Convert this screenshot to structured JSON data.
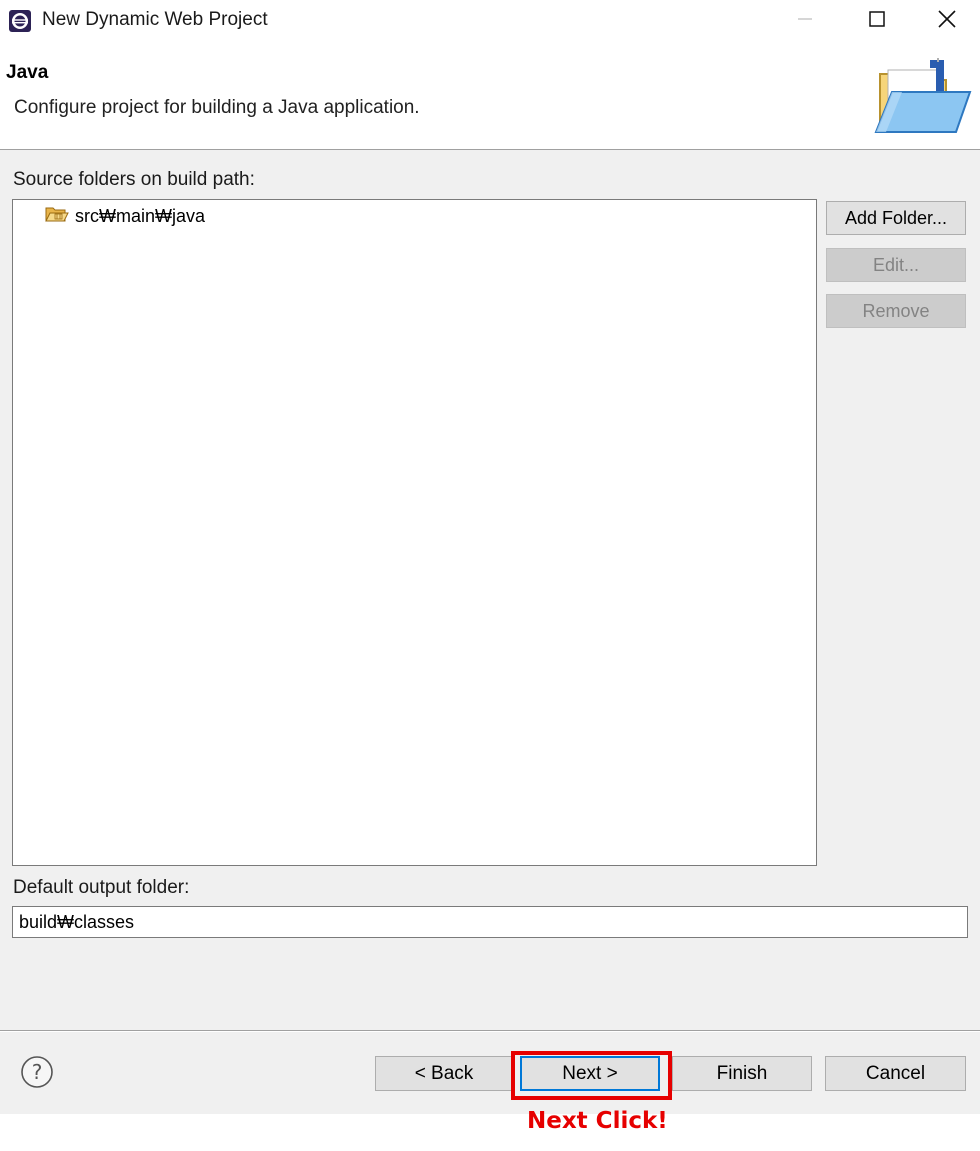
{
  "window": {
    "title": "New Dynamic Web Project",
    "icons": {
      "app": "eclipse-icon",
      "minimize": "minimize-icon",
      "maximize": "maximize-icon",
      "close": "close-icon"
    }
  },
  "header": {
    "title": "Java",
    "description": "Configure project for building a Java application.",
    "icon": "java-folder-banner-icon"
  },
  "source_folders": {
    "label": "Source folders on build path:",
    "items": [
      {
        "label": "src₩main₩java",
        "icon": "source-folder-icon"
      }
    ],
    "buttons": {
      "add": "Add Folder...",
      "edit": "Edit...",
      "remove": "Remove"
    }
  },
  "output": {
    "label": "Default output folder:",
    "value": "build₩classes"
  },
  "footer": {
    "help_icon": "help-icon",
    "back": "< Back",
    "next": "Next >",
    "finish": "Finish",
    "cancel": "Cancel"
  },
  "annotation": {
    "text": "Next Click!",
    "color": "#e60000"
  },
  "colors": {
    "accent": "#0078d7",
    "highlight": "#e60000"
  }
}
